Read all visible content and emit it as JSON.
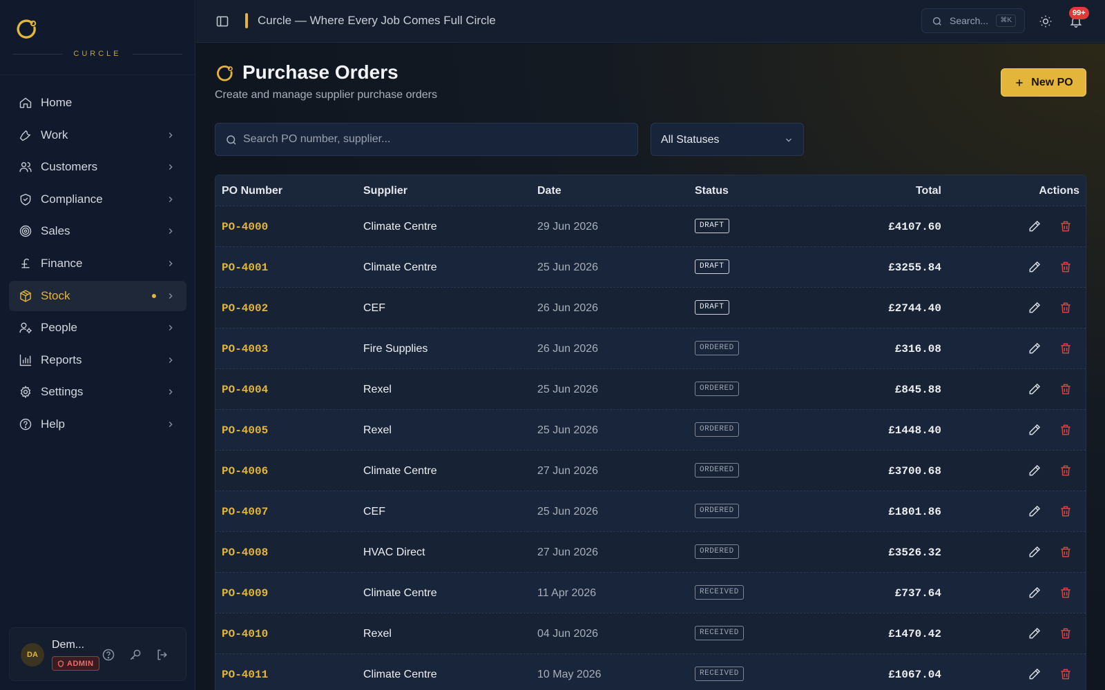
{
  "brand": {
    "wordmark": "CURCLE"
  },
  "sidebar": {
    "items": [
      {
        "label": "Home",
        "icon": "home-icon",
        "chevron": false
      },
      {
        "label": "Work",
        "icon": "wrench-icon",
        "chevron": true
      },
      {
        "label": "Customers",
        "icon": "users-icon",
        "chevron": true
      },
      {
        "label": "Compliance",
        "icon": "shield-icon",
        "chevron": true
      },
      {
        "label": "Sales",
        "icon": "target-icon",
        "chevron": true
      },
      {
        "label": "Finance",
        "icon": "pound-icon",
        "chevron": true
      },
      {
        "label": "Stock",
        "icon": "package-icon",
        "chevron": true,
        "active": true
      },
      {
        "label": "People",
        "icon": "user-cog-icon",
        "chevron": true
      },
      {
        "label": "Reports",
        "icon": "bar-chart-icon",
        "chevron": true
      },
      {
        "label": "Settings",
        "icon": "gear-icon",
        "chevron": true
      },
      {
        "label": "Help",
        "icon": "help-circle-icon",
        "chevron": true
      }
    ]
  },
  "user": {
    "initials": "DA",
    "name": "Dem...",
    "role": "ADMIN"
  },
  "topbar": {
    "title": "Curcle — Where Every Job Comes Full Circle",
    "search_label": "Search...",
    "shortcut": "⌘K",
    "notifications": "99+"
  },
  "page": {
    "title": "Purchase Orders",
    "subtitle": "Create and manage supplier purchase orders",
    "new_button": "New PO"
  },
  "filters": {
    "search_placeholder": "Search PO number, supplier...",
    "status_value": "All Statuses"
  },
  "table": {
    "headers": {
      "po": "PO Number",
      "supplier": "Supplier",
      "date": "Date",
      "status": "Status",
      "total": "Total",
      "actions": "Actions"
    },
    "rows": [
      {
        "po": "PO-4000",
        "supplier": "Climate Centre",
        "date": "29 Jun 2026",
        "status": "DRAFT",
        "total": "£4107.60"
      },
      {
        "po": "PO-4001",
        "supplier": "Climate Centre",
        "date": "25 Jun 2026",
        "status": "DRAFT",
        "total": "£3255.84"
      },
      {
        "po": "PO-4002",
        "supplier": "CEF",
        "date": "26 Jun 2026",
        "status": "DRAFT",
        "total": "£2744.40"
      },
      {
        "po": "PO-4003",
        "supplier": "Fire Supplies",
        "date": "26 Jun 2026",
        "status": "ORDERED",
        "total": "£316.08"
      },
      {
        "po": "PO-4004",
        "supplier": "Rexel",
        "date": "25 Jun 2026",
        "status": "ORDERED",
        "total": "£845.88"
      },
      {
        "po": "PO-4005",
        "supplier": "Rexel",
        "date": "25 Jun 2026",
        "status": "ORDERED",
        "total": "£1448.40"
      },
      {
        "po": "PO-4006",
        "supplier": "Climate Centre",
        "date": "27 Jun 2026",
        "status": "ORDERED",
        "total": "£3700.68"
      },
      {
        "po": "PO-4007",
        "supplier": "CEF",
        "date": "25 Jun 2026",
        "status": "ORDERED",
        "total": "£1801.86"
      },
      {
        "po": "PO-4008",
        "supplier": "HVAC Direct",
        "date": "27 Jun 2026",
        "status": "ORDERED",
        "total": "£3526.32"
      },
      {
        "po": "PO-4009",
        "supplier": "Climate Centre",
        "date": "11 Apr 2026",
        "status": "RECEIVED",
        "total": "£737.64"
      },
      {
        "po": "PO-4010",
        "supplier": "Rexel",
        "date": "04 Jun 2026",
        "status": "RECEIVED",
        "total": "£1470.42"
      },
      {
        "po": "PO-4011",
        "supplier": "Climate Centre",
        "date": "10 May 2026",
        "status": "RECEIVED",
        "total": "£1067.04"
      }
    ]
  },
  "colors": {
    "accent": "#e3b63b",
    "danger": "#d64545",
    "background": "#0f1623"
  }
}
